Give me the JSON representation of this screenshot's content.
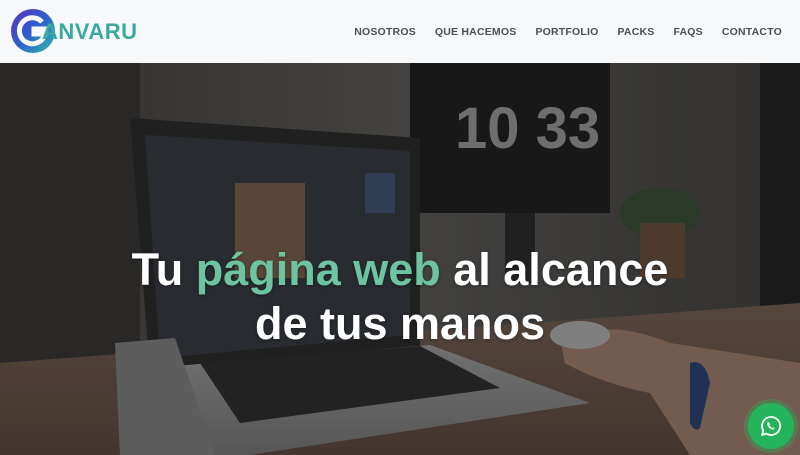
{
  "brand": {
    "name": "ANVARU",
    "colors": {
      "accent": "#3aa99f",
      "primary": "#3b4dbf"
    }
  },
  "nav": {
    "items": [
      {
        "label": "NOSOTROS"
      },
      {
        "label": "QUE HACEMOS"
      },
      {
        "label": "PORTFOLIO"
      },
      {
        "label": "PACKS"
      },
      {
        "label": "FAQS"
      },
      {
        "label": "CONTACTO"
      }
    ]
  },
  "hero": {
    "headline_pre": "Tu ",
    "headline_accent": "página web",
    "headline_post": " al alcance",
    "headline_line2": "de tus manos",
    "clock_text": "10 33",
    "accent_color": "#6cc4a0"
  },
  "whatsapp": {
    "icon": "whatsapp-icon",
    "color": "#25b35b"
  }
}
